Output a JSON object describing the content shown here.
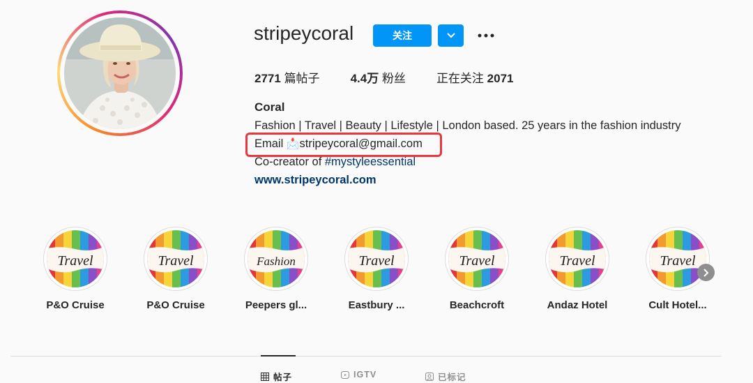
{
  "profile": {
    "username": "stripeycoral",
    "follow_label": "关注",
    "stats": {
      "posts_value": "2771",
      "posts_label": "篇帖子",
      "followers_value": "4.4万",
      "followers_label": "粉丝",
      "following_label": "正在关注",
      "following_value": "2071"
    },
    "bio": {
      "name": "Coral",
      "line1": "Fashion | Travel | Beauty | Lifestyle | London based. 25 years in the fashion industry",
      "email_prefix": "Email ",
      "email_emoji": "📩",
      "email_address": "stripeycoral@gmail.com",
      "line3_prefix": "Co-creator of ",
      "hashtag": "#mystyleessential",
      "website": "www.stripeycoral.com"
    }
  },
  "highlights": [
    {
      "label": "P&O Cruise",
      "cover_text": "Travel"
    },
    {
      "label": "P&O Cruise",
      "cover_text": "Travel"
    },
    {
      "label": "Peepers gl...",
      "cover_text": "Fashion"
    },
    {
      "label": "Eastbury ...",
      "cover_text": "Travel"
    },
    {
      "label": "Beachcroft",
      "cover_text": "Travel"
    },
    {
      "label": "Andaz Hotel",
      "cover_text": "Travel"
    },
    {
      "label": "Cult Hotel...",
      "cover_text": "Travel"
    }
  ],
  "tabs": [
    {
      "label": "帖子",
      "icon": "grid-icon",
      "active": true
    },
    {
      "label": "IGTV",
      "icon": "igtv-icon",
      "active": false
    },
    {
      "label": "已标记",
      "icon": "tagged-icon",
      "active": false
    }
  ],
  "colors": {
    "accent": "#0095f6",
    "highlight_box": "#e8383d",
    "link": "#00376b"
  }
}
